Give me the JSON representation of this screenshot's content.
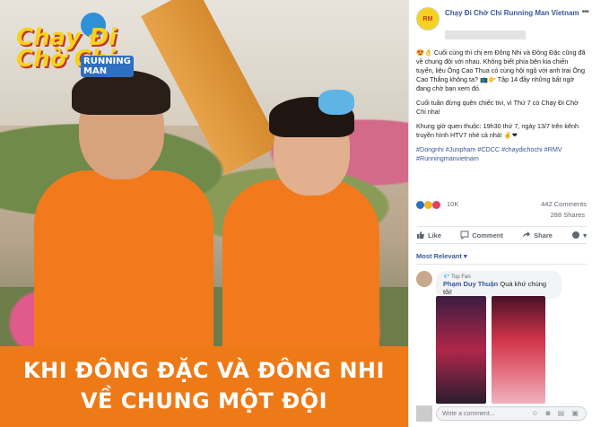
{
  "photo": {
    "logo_line1": "Chạy Đi",
    "logo_line2": "Chờ Chi",
    "logo_sub": "RUNNING MAN",
    "banner_line1": "KHI ĐÔNG ĐẶC VÀ ĐÔNG NHI",
    "banner_line2": "VỀ CHUNG MỘT ĐỘI"
  },
  "post": {
    "page_name": "Chạy Đi Chờ Chi Running Man Vietnam",
    "avatar_text": "RM",
    "para1": "😍👌 Cuối cùng thì chị em Đông Nhi và Đông Đặc cũng đã về chung đội với nhau. Không biết phía bên kia chiến tuyến, liệu Ông Cao Thua có cùng hội ngộ với anh trai Ông Cao Thắng không ta? 📺👉 Tập 14 đầy những bất ngờ đang chờ bạn xem đó.",
    "para2": "Cuối tuần đừng quên chiếc tivi, vì Thứ 7 có Chạy Đi Chờ Chi nha!",
    "para3": "Khung giờ quen thuộc: 19h30 thứ 7, ngày 13/7 trên kênh truyền hình HTV7 nhé cả nhà! ✌❤",
    "hashtags": "#Dongnhi #Junpham #CDCC #chaydichochi #RMV #Runningmanvietnam",
    "reaction_count": "10K",
    "comment_count": "442 Comments",
    "share_count": "288 Shares",
    "like_label": "Like",
    "comment_label": "Comment",
    "share_label": "Share",
    "relevance": "Most Relevant ▾"
  },
  "comment": {
    "badge": "💎 Top Fan",
    "name": "Phạm Duy Thuận",
    "text": "Quá khứ chúng tôi!"
  },
  "composer": {
    "placeholder": "Write a comment..."
  },
  "colors": {
    "link": "#385898",
    "orange": "#ee7a17",
    "like_blue": "#2f6fbf",
    "love_red": "#e4405f",
    "haha_yellow": "#f7b125"
  }
}
